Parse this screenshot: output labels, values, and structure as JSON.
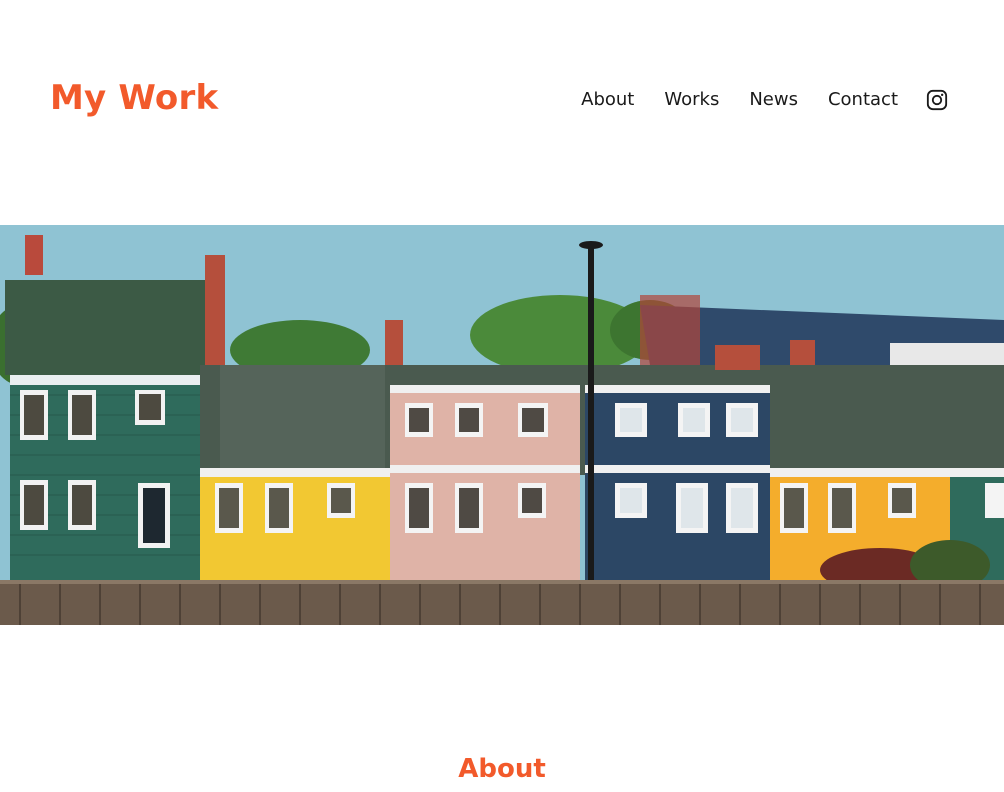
{
  "site": {
    "logo": "My Work"
  },
  "nav": {
    "items": [
      "About",
      "Works",
      "News",
      "Contact"
    ],
    "social_icon": "instagram-icon"
  },
  "hero": {
    "image_description": "row-of-colorful-houses"
  },
  "section": {
    "title": "About"
  },
  "colors": {
    "accent": "#f25a2b",
    "text": "#1a1a1a",
    "background": "#ffffff"
  }
}
